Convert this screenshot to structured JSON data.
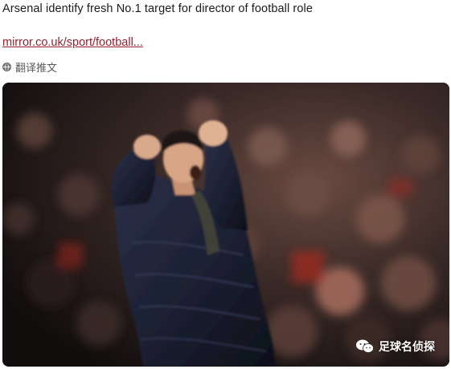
{
  "tweet": {
    "text": "Arsenal identify fresh No.1 target for director of football role",
    "link_text": "mirror.co.uk/sport/football...",
    "translate_label": "翻译推文"
  },
  "media": {
    "description_icon": "photo",
    "watermark_text": "足球名侦探",
    "watermark_icon": "wechat-icon"
  },
  "colors": {
    "link": "#9a1f2a",
    "text": "#1c1c1c",
    "muted": "#5a5a5a"
  }
}
